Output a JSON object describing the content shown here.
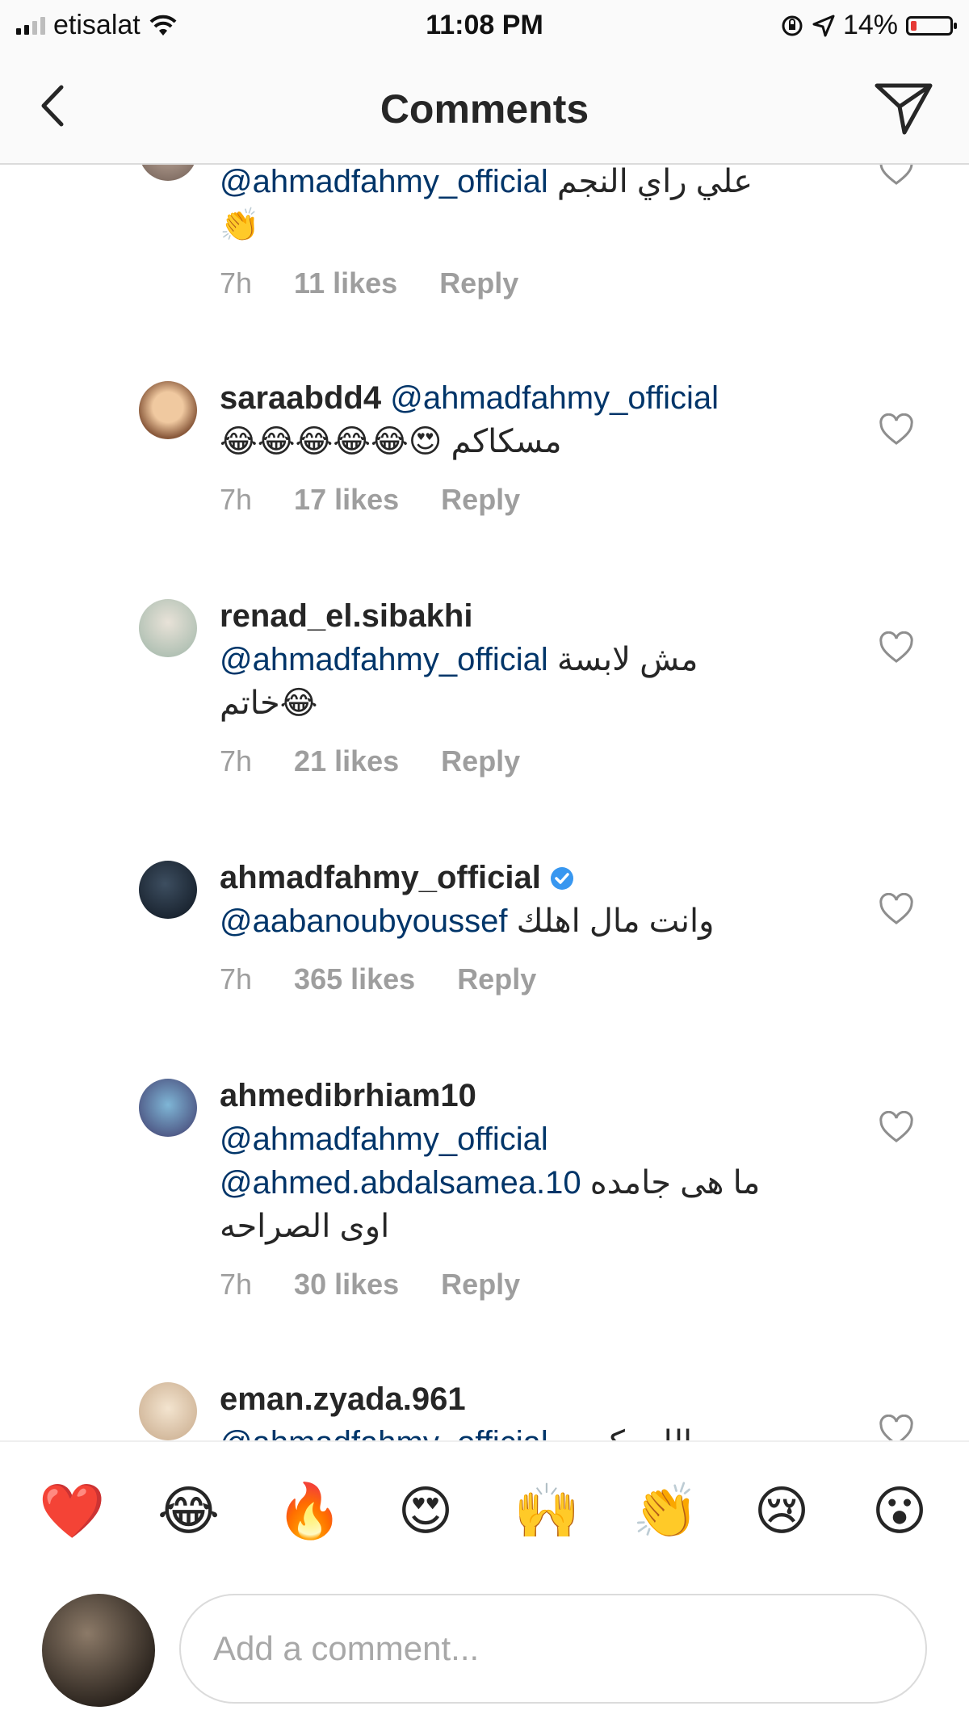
{
  "status_bar": {
    "carrier": "etisalat",
    "time": "11:08 PM",
    "battery": "14%"
  },
  "header": {
    "title": "Comments"
  },
  "comments": [
    {
      "username": "",
      "mention": "@ahmadfahmy_official",
      "text": "علي راي النجم",
      "emoji": "👏",
      "time": "7h",
      "likes": "11 likes",
      "reply": "Reply"
    },
    {
      "username": "saraabdd4",
      "mention": "@ahmadfahmy_official",
      "text": "مسكاكم",
      "emoji": "😂😂😂😂😂😍",
      "time": "7h",
      "likes": "17 likes",
      "reply": "Reply"
    },
    {
      "username": "renad_el.sibakhi",
      "mention": "@ahmadfahmy_official",
      "text": "مش لابسة",
      "text2": "خاتم😂",
      "time": "7h",
      "likes": "21 likes",
      "reply": "Reply"
    },
    {
      "username": "ahmadfahmy_official",
      "verified": true,
      "mention": "@aabanoubyoussef",
      "text": "وانت مال اهلك",
      "time": "7h",
      "likes": "365 likes",
      "reply": "Reply"
    },
    {
      "username": "ahmedibrhiam10",
      "mention": "@ahmadfahmy_official",
      "mention2": "@ahmed.abdalsamea.10",
      "text": "ما هى جامده",
      "text2": "اوى الصراحه",
      "time": "7h",
      "likes": "30 likes",
      "reply": "Reply"
    },
    {
      "username": "eman.zyada.961",
      "mention": "@ahmadfahmy_official",
      "text": "الله يكرمه"
    }
  ],
  "reactions": [
    {
      "icon": "heart-emoji",
      "glyph": "❤️"
    },
    {
      "icon": "tears-of-joy-emoji",
      "glyph": "😂"
    },
    {
      "icon": "fire-emoji",
      "glyph": "🔥"
    },
    {
      "icon": "heart-eyes-emoji",
      "glyph": "😍"
    },
    {
      "icon": "raised-hands-emoji",
      "glyph": "🙌"
    },
    {
      "icon": "clapping-hands-emoji",
      "glyph": "👏"
    },
    {
      "icon": "crying-face-emoji",
      "glyph": "😢"
    },
    {
      "icon": "astonished-face-emoji",
      "glyph": "😮"
    }
  ],
  "composer": {
    "placeholder": "Add a comment..."
  },
  "colors": {
    "mention": "#003569",
    "meta": "#9e9e9e",
    "verified": "#3897f0",
    "battery_low": "#e53935"
  }
}
